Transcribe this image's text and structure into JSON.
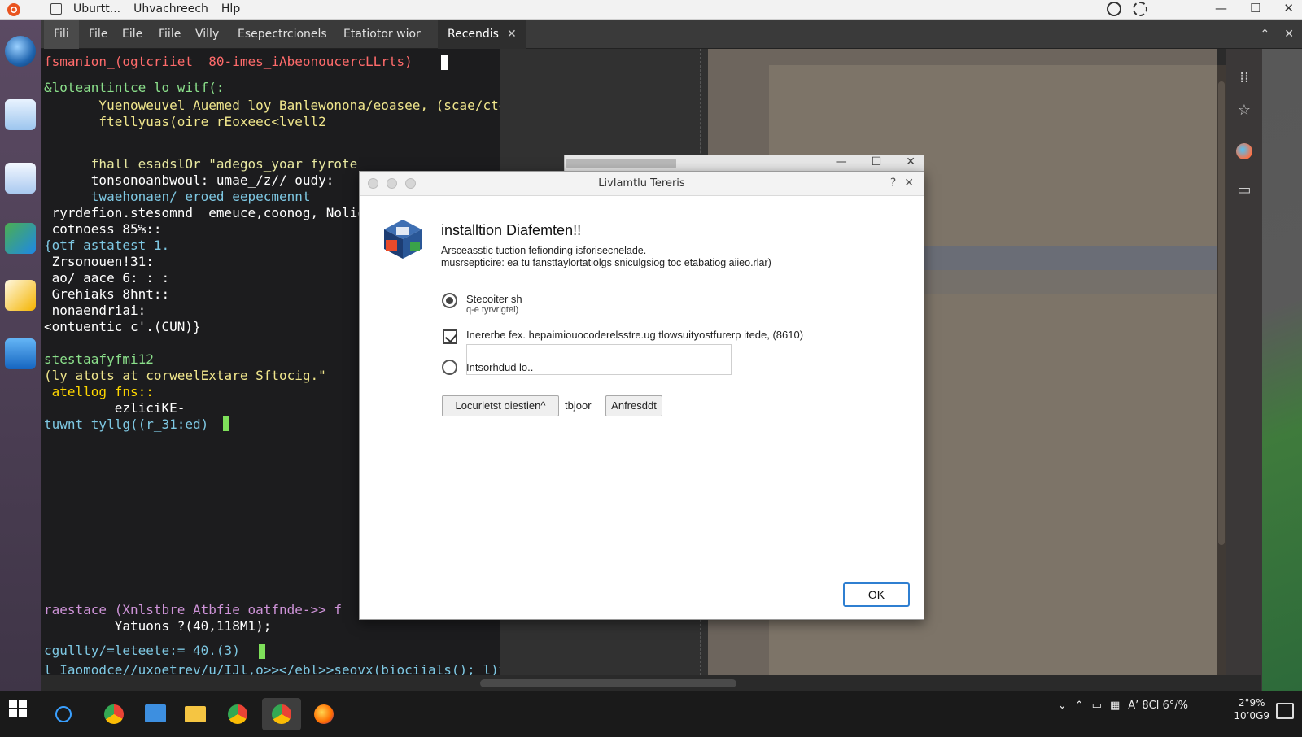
{
  "topbar": {
    "menus": [
      "Uburtt...",
      "Uhvachreech",
      "Hlp"
    ]
  },
  "tabs": [
    {
      "label": "Fili"
    },
    {
      "label": "File"
    },
    {
      "label": "Eile"
    },
    {
      "label": "Fiile"
    },
    {
      "label": "Villy"
    },
    {
      "label": "Esepectrcionels"
    },
    {
      "label": "Etatiotor wior"
    },
    {
      "label": "Recendis"
    }
  ],
  "terminal": {
    "lines": [
      {
        "text": "fsmanion_(ogtcriiet  80-imes_iAbeonoucercLLrts)",
        "color": "#ff6b6b"
      },
      {
        "text": "&loteantintce lo witf(:",
        "color": "#8be08b"
      },
      {
        "text": "       Yuenoweuvel Auemed loy Banlewonona/eoasee, (scae/ctetsapoeile-fesog'),",
        "color": "#f0e68c"
      },
      {
        "text": "       ftellyuas(oire rEoxeec<lvell2",
        "color": "#f0e68c"
      },
      {
        "text": "      fhall esadslOr \"adegos_yoar fyrote",
        "color": "#e8e8a0"
      },
      {
        "text": "      tonsonoanbwoul: umae_/z// oudy:",
        "color": "#ffffff"
      },
      {
        "text": "      twaehonaen/ eroed eepecmennt",
        "color": "#7ec8e3"
      },
      {
        "text": " ryrdefion.stesomnd_ emeuce,coonog, Nolio",
        "color": "#ffffff"
      },
      {
        "text": " cotnoess 85%::",
        "color": "#ffffff"
      },
      {
        "text": "{otf astatest 1.",
        "color": "#7ec8e3"
      },
      {
        "text": " Zrsonouen!31:",
        "color": "#ffffff"
      },
      {
        "text": " ao/ aace 6: : :",
        "color": "#ffffff"
      },
      {
        "text": " Grehiaks 8hnt::",
        "color": "#ffffff"
      },
      {
        "text": " nonaendriai:",
        "color": "#ffffff"
      },
      {
        "text": "<ontuentic_c'.(CUN)}",
        "color": "#ffffff"
      },
      {
        "text": "stestaafyfmi12",
        "color": "#8be08b"
      },
      {
        "text": "(ly atots at corweelExtare Sftocig.\"",
        "color": "#f0e68c"
      },
      {
        "text": " atellog fns::",
        "color": "#ffd700"
      },
      {
        "text": "         ezliciKE-",
        "color": "#ffffff"
      },
      {
        "text": "tuwnt tyllg((r_31:ed)",
        "color": "#7ec8e3"
      },
      {
        "text": "raestace (Xnlstbre Atbfie oatfnde->> f",
        "color": "#ce93d8"
      },
      {
        "text": "         Yatuons ?(40,118M1);",
        "color": "#ffffff"
      },
      {
        "text": "cgullty/=leteete:= 40.(3)",
        "color": "#7ec8e3"
      },
      {
        "text": "l Iaomodce//uxoetrev/u/IJl,o>></ebl>>seovx(biociials(); l)y",
        "color": "#7ec8e3"
      }
    ]
  },
  "dialog_back": {
    "controls": [
      "—",
      "☐",
      "✕"
    ]
  },
  "dialog": {
    "title": "Livlamtlu Tereris",
    "title_help": "?",
    "title_close": "✕",
    "heading": "installtion Diafemten!!",
    "desc1": "Arsceasstic tuction fefionding isforisecnelade.",
    "desc2": "musrsepticire: ea tu fansttaylortatiolgs sniculgsiog toc etabatiog aiieo.rlar)",
    "option1_label": "Stecoiter sh",
    "option1_sub": "q-e tyrvrigtel)",
    "checkbox_label": "Inererbe fex. hepaimiouocoderelsstre.ug tlowsuityostfurerp itede, (8610)",
    "option3_label": "Intsorhdud lo..",
    "btn1": "Locurletst oiestien^",
    "btn_mid": "tbjoor",
    "btn2": "Anfresddt",
    "ok": "OK"
  },
  "taskbar": {
    "tray_text": "A’ 8Cl 6°/%",
    "clock_line1": "2°9%",
    "clock_line2": "10’0G9"
  }
}
